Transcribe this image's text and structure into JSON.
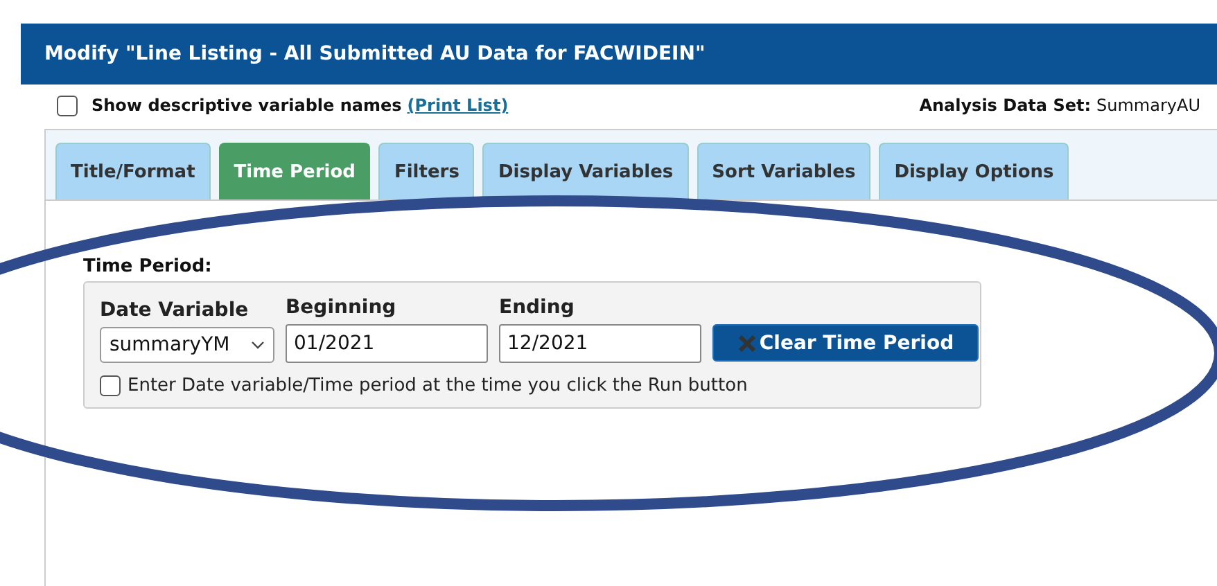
{
  "window": {
    "title": "Modify \"Line Listing - All Submitted AU Data for FACWIDEIN\""
  },
  "options": {
    "show_descriptive": {
      "label": "Show descriptive variable names",
      "checked": false
    },
    "print_link": "(Print List)",
    "dataset_label": "Analysis Data Set:",
    "dataset_value": "SummaryAU"
  },
  "tabs": [
    {
      "label": "Title/Format",
      "selected": false
    },
    {
      "label": "Time Period",
      "selected": true
    },
    {
      "label": "Filters",
      "selected": false
    },
    {
      "label": "Display Variables",
      "selected": false
    },
    {
      "label": "Sort Variables",
      "selected": false
    },
    {
      "label": "Display Options",
      "selected": false
    }
  ],
  "time_period": {
    "heading": "Time Period:",
    "date_variable": {
      "label": "Date Variable",
      "value": "summaryYM"
    },
    "beginning": {
      "label": "Beginning",
      "value": "01/2021"
    },
    "ending": {
      "label": "Ending",
      "value": "12/2021"
    },
    "clear_button": "Clear Time Period",
    "run_prompt": {
      "label": "Enter Date variable/Time period at the time you click the Run button",
      "checked": false
    }
  },
  "annotation": {
    "kind": "ellipse"
  }
}
